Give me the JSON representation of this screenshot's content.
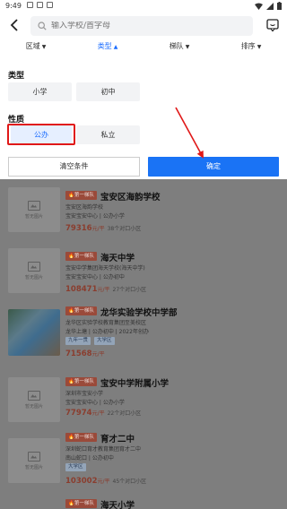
{
  "status": {
    "time": "9:49"
  },
  "search": {
    "placeholder": "输入学校/首字母"
  },
  "filters": [
    {
      "label": "区域",
      "active": false
    },
    {
      "label": "类型",
      "active": true
    },
    {
      "label": "梯队",
      "active": false
    },
    {
      "label": "排序",
      "active": false
    }
  ],
  "type_section": {
    "title": "类型",
    "options": [
      "小学",
      "初中"
    ]
  },
  "nature_section": {
    "title": "性质",
    "options": [
      "公办",
      "私立"
    ],
    "selected": "公办"
  },
  "actions": {
    "clear": "清空条件",
    "confirm": "确定"
  },
  "colors": {
    "accent": "#1a73f5",
    "highlight": "#e01818"
  },
  "schools": [
    {
      "badge": "第一梯队",
      "name": "宝安区海韵学校",
      "lines": [
        "宝安区海韵学校",
        "宝安宝安中心 | 公办小学"
      ],
      "tags": [],
      "price": "79316",
      "unit": "元/平",
      "extra": "38个对口小区",
      "image": "暂无图片"
    },
    {
      "badge": "第一梯队",
      "name": "海天中学",
      "lines": [
        "宝安中学集团海天学校(海天中学)",
        "宝安宝安中心 | 公办初中"
      ],
      "tags": [],
      "price": "108471",
      "unit": "元/平",
      "extra": "27个对口小区",
      "image": "暂无图片"
    },
    {
      "badge": "第一梯队",
      "name": "龙华实验学校中学部",
      "lines": [
        "龙华区实验学校教育集团至美校区",
        "龙华上塘 | 公办初中 | 2022年创办"
      ],
      "tags": [
        "九年一贯",
        "大学区"
      ],
      "price": "71568",
      "unit": "元/平",
      "extra": "",
      "image": ""
    },
    {
      "badge": "第一梯队",
      "name": "宝安中学附属小学",
      "lines": [
        "深圳市宝安小学",
        "宝安宝安中心 | 公办小学"
      ],
      "tags": [],
      "price": "77974",
      "unit": "元/平",
      "extra": "22个对口小区",
      "image": "暂无图片"
    },
    {
      "badge": "第一梯队",
      "name": "育才二中",
      "lines": [
        "深圳蛇口育才教育集团育才二中",
        "南山蛇口 | 公办初中"
      ],
      "tags": [
        "大学区"
      ],
      "price": "103002",
      "unit": "元/平",
      "extra": "45个对口小区",
      "image": "暂无图片"
    },
    {
      "badge": "第一梯队",
      "name": "海天小学",
      "lines": [],
      "tags": [],
      "price": "",
      "unit": "",
      "extra": "",
      "image": ""
    }
  ]
}
